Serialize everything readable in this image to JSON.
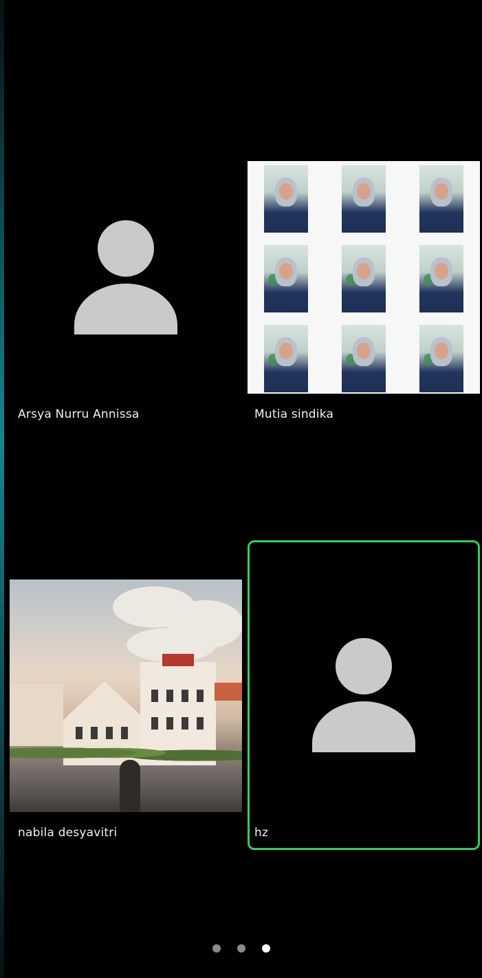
{
  "participants": [
    {
      "name": "Arsya Nurru Annissa",
      "video": "off",
      "active_speaker": false
    },
    {
      "name": "Mutia sindika",
      "video": "on",
      "active_speaker": false
    },
    {
      "name": "nabila desyavitri",
      "video": "on",
      "active_speaker": false
    },
    {
      "name": "hz",
      "video": "off",
      "active_speaker": true
    }
  ],
  "pagination": {
    "pages": 3,
    "current": 3
  },
  "colors": {
    "background": "#000000",
    "active_speaker_border": "#2fcf62",
    "avatar_placeholder": "#cacaca",
    "page_dot": "#8a8a8a",
    "page_dot_active": "#ffffff"
  },
  "icons": {
    "avatar": "person-placeholder-icon"
  }
}
